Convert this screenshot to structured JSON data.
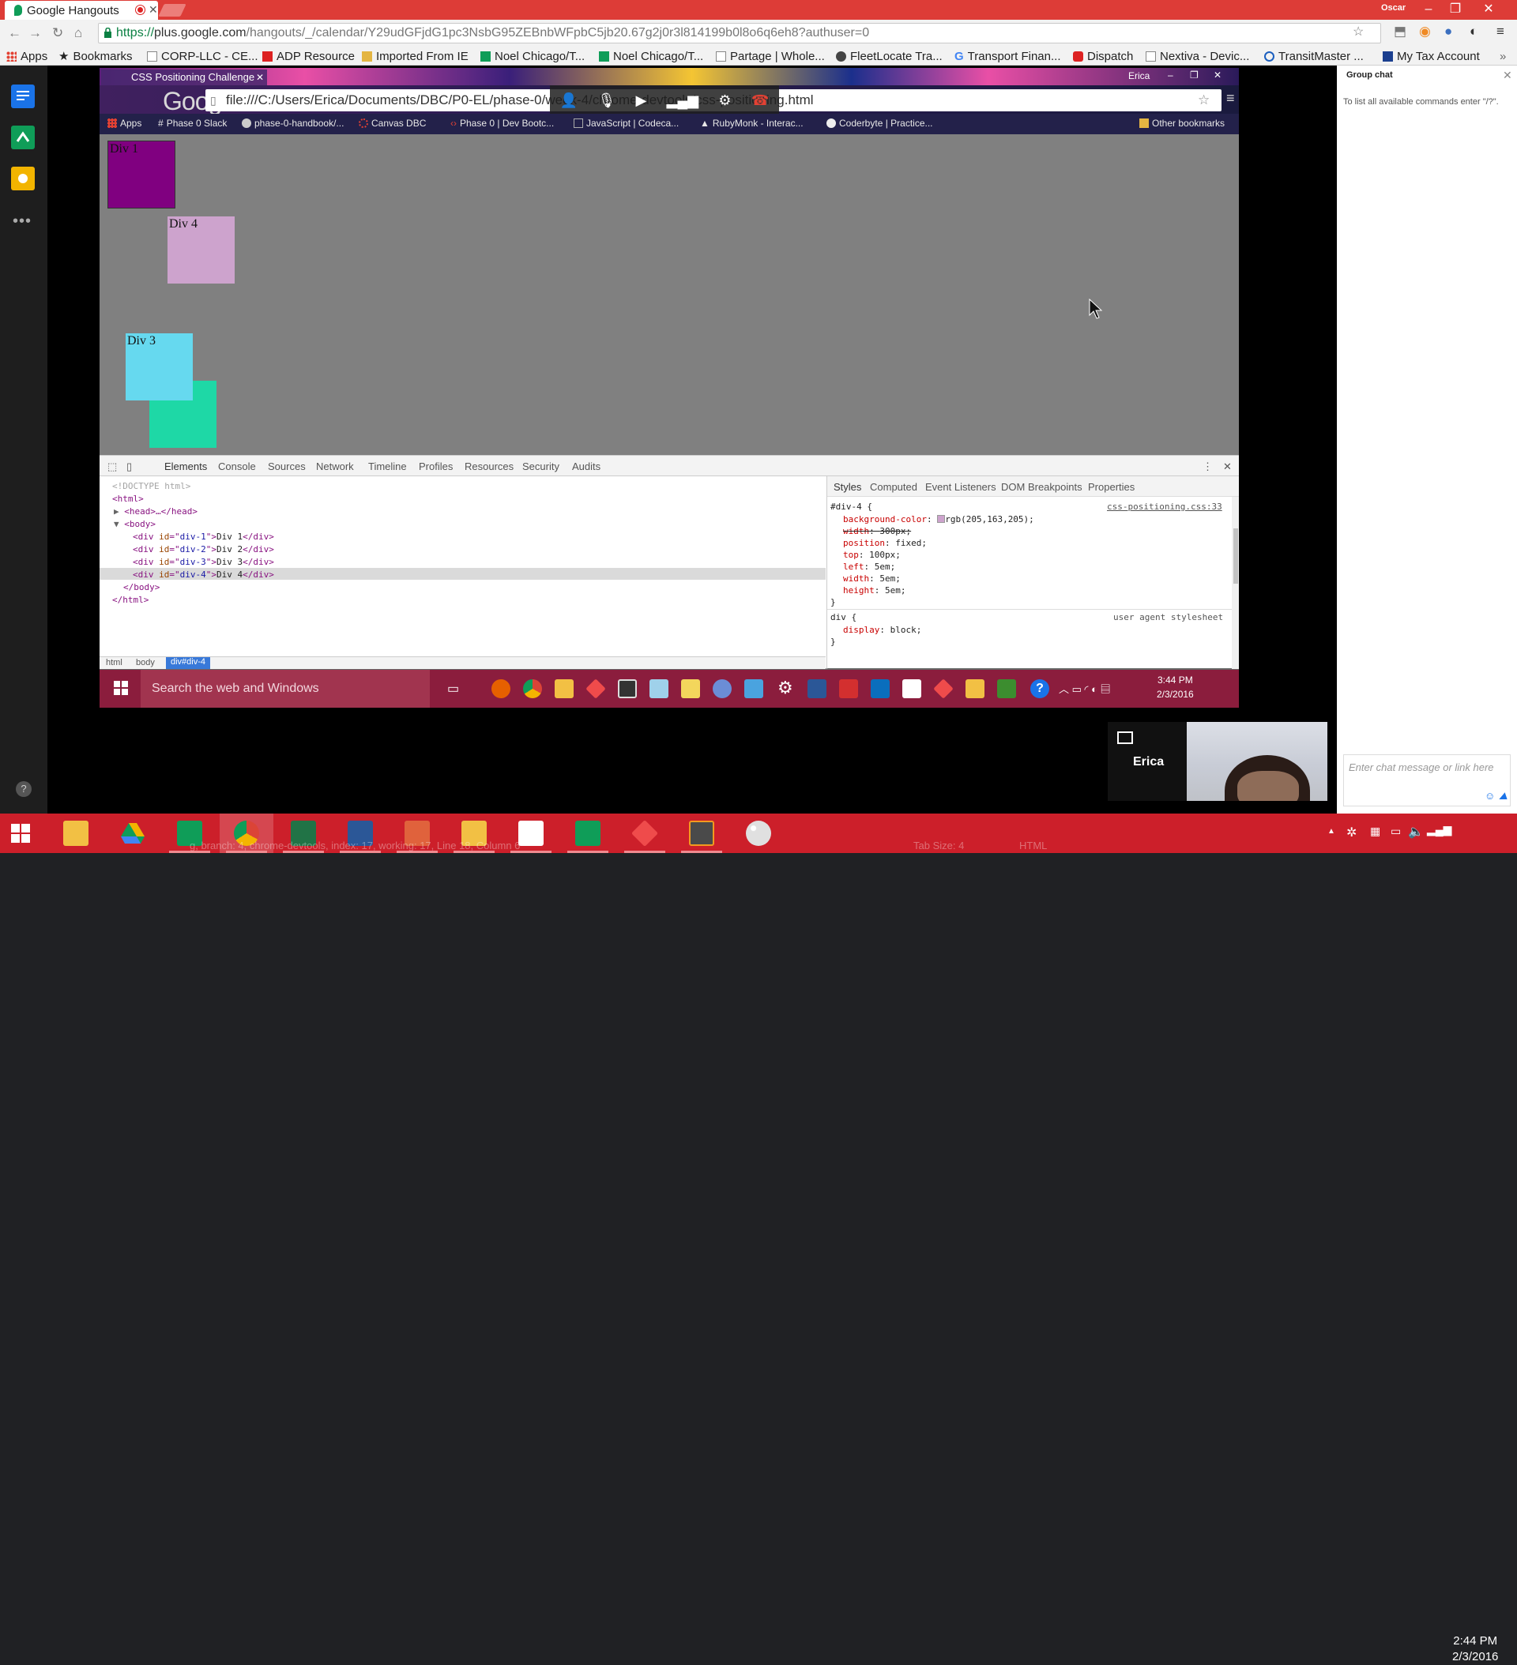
{
  "colors": {
    "accent_red": "#dd3c37",
    "taskbar_red": "#cc1f2a",
    "div1": "#800080",
    "div4": "#cda3cd",
    "div3": "#66d9ef",
    "div2": "#1ed8a6"
  },
  "browser": {
    "tab_title": "Google Hangouts",
    "profile": "Oscar",
    "url_scheme": "https://",
    "url_host": "plus.google.com",
    "url_path": "/hangouts/_/calendar/Y29udGFjdG1pc3NsbG95ZEBnbWFpbC5jb20.67g2j0r3l814199b0l8o6q6eh8?authuser=0",
    "bookmarks": [
      {
        "label": "Apps",
        "icon": "apps-icon"
      },
      {
        "label": "Bookmarks",
        "icon": "star-icon"
      },
      {
        "label": "CORP-LLC - CE...",
        "icon": "page-icon"
      },
      {
        "label": "ADP Resource",
        "icon": "adp-icon"
      },
      {
        "label": "Imported From IE",
        "icon": "folder-icon"
      },
      {
        "label": "Noel Chicago/T...",
        "icon": "sheet-icon"
      },
      {
        "label": "Noel Chicago/T...",
        "icon": "sheet-icon"
      },
      {
        "label": "Partage | Whole...",
        "icon": "page-icon"
      },
      {
        "label": "FleetLocate Tra...",
        "icon": "fleet-icon"
      },
      {
        "label": "Transport Finan...",
        "icon": "google-icon"
      },
      {
        "label": "Dispatch",
        "icon": "pin-icon"
      },
      {
        "label": "Nextiva - Devic...",
        "icon": "page-icon"
      },
      {
        "label": "TransitMaster ...",
        "icon": "transit-icon"
      },
      {
        "label": "My Tax Account",
        "icon": "tax-icon"
      }
    ]
  },
  "shared": {
    "tab_title": "CSS Positioning Challenge",
    "user": "Erica",
    "logo": "Google",
    "url": "file:///C:/Users/Erica/Documents/DBC/P0-EL/phase-0/week-4/chrome-devtools/css-positioning.html",
    "bookmarks": [
      {
        "label": "Apps"
      },
      {
        "label": "Phase 0 Slack"
      },
      {
        "label": "phase-0-handbook/..."
      },
      {
        "label": "Canvas DBC"
      },
      {
        "label": "Phase 0 | Dev Bootc..."
      },
      {
        "label": "JavaScript | Codeca..."
      },
      {
        "label": "RubyMonk - Interac..."
      },
      {
        "label": "Coderbyte | Practice..."
      }
    ],
    "other_bookmarks": "Other bookmarks",
    "divs": {
      "div1": "Div 1",
      "div4": "Div 4",
      "div3": "Div 3"
    },
    "devtools": {
      "tabs": [
        "Elements",
        "Console",
        "Sources",
        "Network",
        "Timeline",
        "Profiles",
        "Resources",
        "Security",
        "Audits"
      ],
      "dom": {
        "doctype": "<!DOCTYPE html>",
        "html_open": "<html>",
        "head": "<head>…</head>",
        "body_open": "<body>",
        "rows": [
          {
            "id": "div-1",
            "text": "Div 1"
          },
          {
            "id": "div-2",
            "text": "Div 2"
          },
          {
            "id": "div-3",
            "text": "Div 3"
          },
          {
            "id": "div-4",
            "text": "Div 4"
          }
        ],
        "body_close": "</body>",
        "html_close": "</html>"
      },
      "styles_tabs": [
        "Styles",
        "Computed",
        "Event Listeners",
        "DOM Breakpoints",
        "Properties"
      ],
      "rule1": {
        "selector": "#div-4 {",
        "source": "css-positioning.css:33",
        "props": [
          {
            "name": "background-color",
            "value": "rgb(205,163,205);"
          },
          {
            "name": "width",
            "value": "300px;"
          },
          {
            "name": "position",
            "value": "fixed;"
          },
          {
            "name": "top",
            "value": "100px;"
          },
          {
            "name": "left",
            "value": "5em;"
          },
          {
            "name": "width",
            "value": "5em;"
          },
          {
            "name": "height",
            "value": "5em;"
          }
        ]
      },
      "rule2": {
        "selector": "div {",
        "source": "user agent stylesheet",
        "prop": "display",
        "value": "block;"
      },
      "breadcrumb": [
        "html",
        "body",
        "div#div-4"
      ]
    },
    "taskbar_search": "Search the web and Windows",
    "clock_time": "3:44 PM",
    "clock_date": "2/3/2016"
  },
  "chat": {
    "title": "Group chat",
    "hint": "To list all available commands enter \"/?\".",
    "placeholder": "Enter chat message or link here",
    "tile_name": "Erica"
  },
  "taskbar": {
    "time": "2:44 PM",
    "date": "2/3/2016",
    "ghost_status": "g, branch: 4, chrome-devtools, index: 17, working: 17, Line 18, Column 6",
    "ghost_tab": "Tab Size: 4",
    "ghost_syntax": "HTML"
  }
}
